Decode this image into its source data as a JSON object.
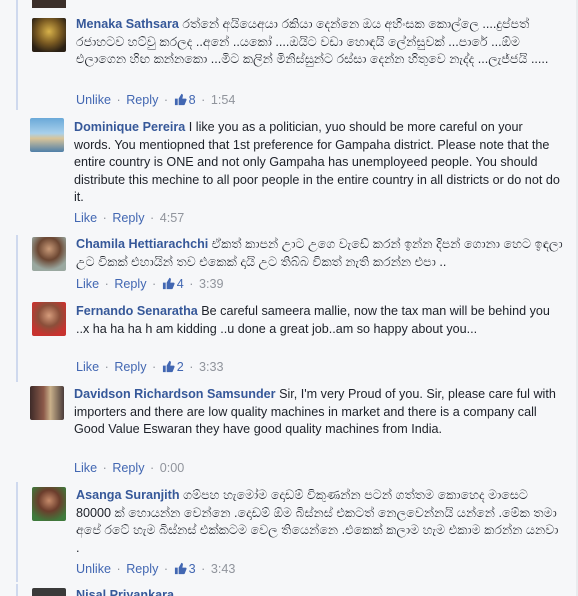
{
  "comments": [
    {
      "name": "Menaka Sathsara",
      "text": "රත්නේ අයියෙඅයා රකියා දෙන්නෙ ඔය අහිංසක කොල්ලෙ ....දුප්පත් රජාහටව හට්වු කරලද ..අනේ ..යකෝ ....ඔයිට වඩා හොඳයි ලේන්සුවක් ...පාරේ ...ඕම එලාගෙන හිඟ කන්නකො ...මිට කලින් මිනිස්සුන්ට රස්සා දෙන්න හිතුවෙ නැද්ද ...ලැජ්ජයි .....",
      "action1": "Unlike",
      "action2": "Reply",
      "likes": "8",
      "time": "1:54"
    },
    {
      "name": "Dominique Pereira",
      "text": "I like you as a politician, yuo should be more careful on your words. You mentiopned that 1st preference for Gampaha district. Please note that the entire country is ONE and not only Gampaha has unemployeed people. You should distribute this mechine to all poor people in the entire country in all districts or do not do it.",
      "action1": "Like",
      "action2": "Reply",
      "likes": "",
      "time": "4:57"
    },
    {
      "name": "Chamila Hettiarachchi",
      "text": "ඒකත් කාපන් උාට උගෙ වැඩේ කරන් ඉන්න දිපන් ගොනා හෙට ඉඳලා උට විකක් එහායින් තව එකෙක් දායි උට තිබ්බ විකත් නැති කරන්න එපා ..",
      "action1": "Like",
      "action2": "Reply",
      "likes": "4",
      "time": "3:39"
    },
    {
      "name": "Fernando Senaratha",
      "text": "Be careful sameera mallie, now the tax man will be behind you ..x ha ha ha h am kidding ..u done a great job..am so happy about you...",
      "action1": "Like",
      "action2": "Reply",
      "likes": "2",
      "time": "3:33"
    },
    {
      "name": "Davidson Richardson Samsunder",
      "text": "Sir, I'm very Proud of you. Sir, please care ful with importers and there are low quality machines in market and there is a company call Good Value Eswaran they have good quality machines from India.",
      "action1": "Like",
      "action2": "Reply",
      "likes": "",
      "time": "0:00"
    },
    {
      "name": "Asanga Suranjith",
      "text": "ගම්පහ හැමෝම දොඩම් විකුණන්න පටන් ගත්තම කොහෙද මාසෙට 80000 ක් හොයන්න වෙන්නෙ .දොඩම් ඕම බිස්නස් එකටත් නෙලවෙන්නයි යන්නේ .මේක තමා අපේ රටේ හැම බිස්නස් එක්කටම වෙල තියෙන්නෙ .එකෙක් කලාම හැම එකාම කරන්න යනවා .",
      "action1": "Unlike",
      "action2": "Reply",
      "likes": "3",
      "time": "3:43"
    },
    {
      "name": "Nisal Priyankara",
      "text": "",
      "action1": "",
      "action2": "",
      "likes": "",
      "time": ""
    }
  ],
  "colors": {
    "link": "#365899",
    "action": "#4267b2",
    "meta": "#90949c",
    "text": "#1d2129",
    "thread_border": "#cfd9ee",
    "background": "#f6f7f9"
  },
  "icons": {
    "like": "thumbs-up-icon"
  }
}
